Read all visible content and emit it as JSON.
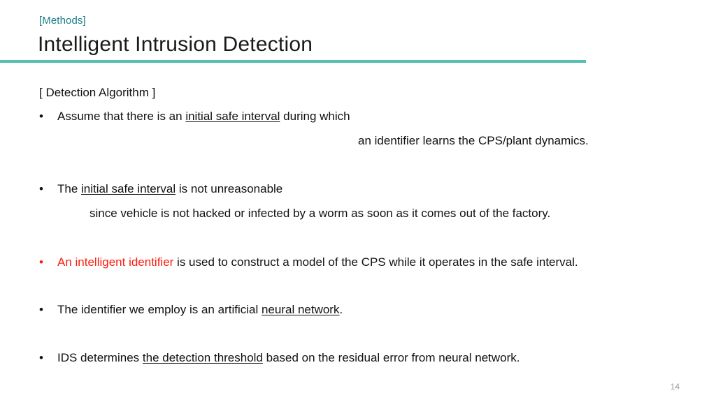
{
  "slide": {
    "kicker": "[Methods]",
    "title": "Intelligent Intrusion Detection",
    "page_number": "14",
    "accent_color": "#57bfb2",
    "kicker_color": "#1b7b87",
    "highlight_color": "#fb1d0e",
    "text_color": "#111111",
    "page_number_color": "#9a9a9a"
  },
  "content": {
    "section_label": "[ Detection Algorithm ]",
    "bullet_marker": "•",
    "bullets": [
      {
        "marker": "•",
        "lead_plain": "Assume that there is an ",
        "underlined": "initial safe interval",
        "trail_plain": " during which",
        "continuation": "an identifier learns the CPS/plant dynamics."
      },
      {
        "marker": "•",
        "lead_plain": "The ",
        "underlined": "initial safe interval",
        "trail_plain": " is not unreasonable",
        "continuation": "since vehicle is not hacked or infected by a worm as soon as it comes out of the factory."
      },
      {
        "marker": "•",
        "highlighted": "An intelligent identifier",
        "trail_plain": " is used to construct a model of the CPS while it operates in the safe interval."
      },
      {
        "marker": "•",
        "lead_plain": "The identifier we employ is an artificial ",
        "underlined": "neural network",
        "trail_plain": "."
      },
      {
        "marker": "•",
        "lead_plain": "IDS determines ",
        "underlined": "the detection threshold",
        "trail_plain": " based on the residual error from neural network."
      }
    ]
  }
}
